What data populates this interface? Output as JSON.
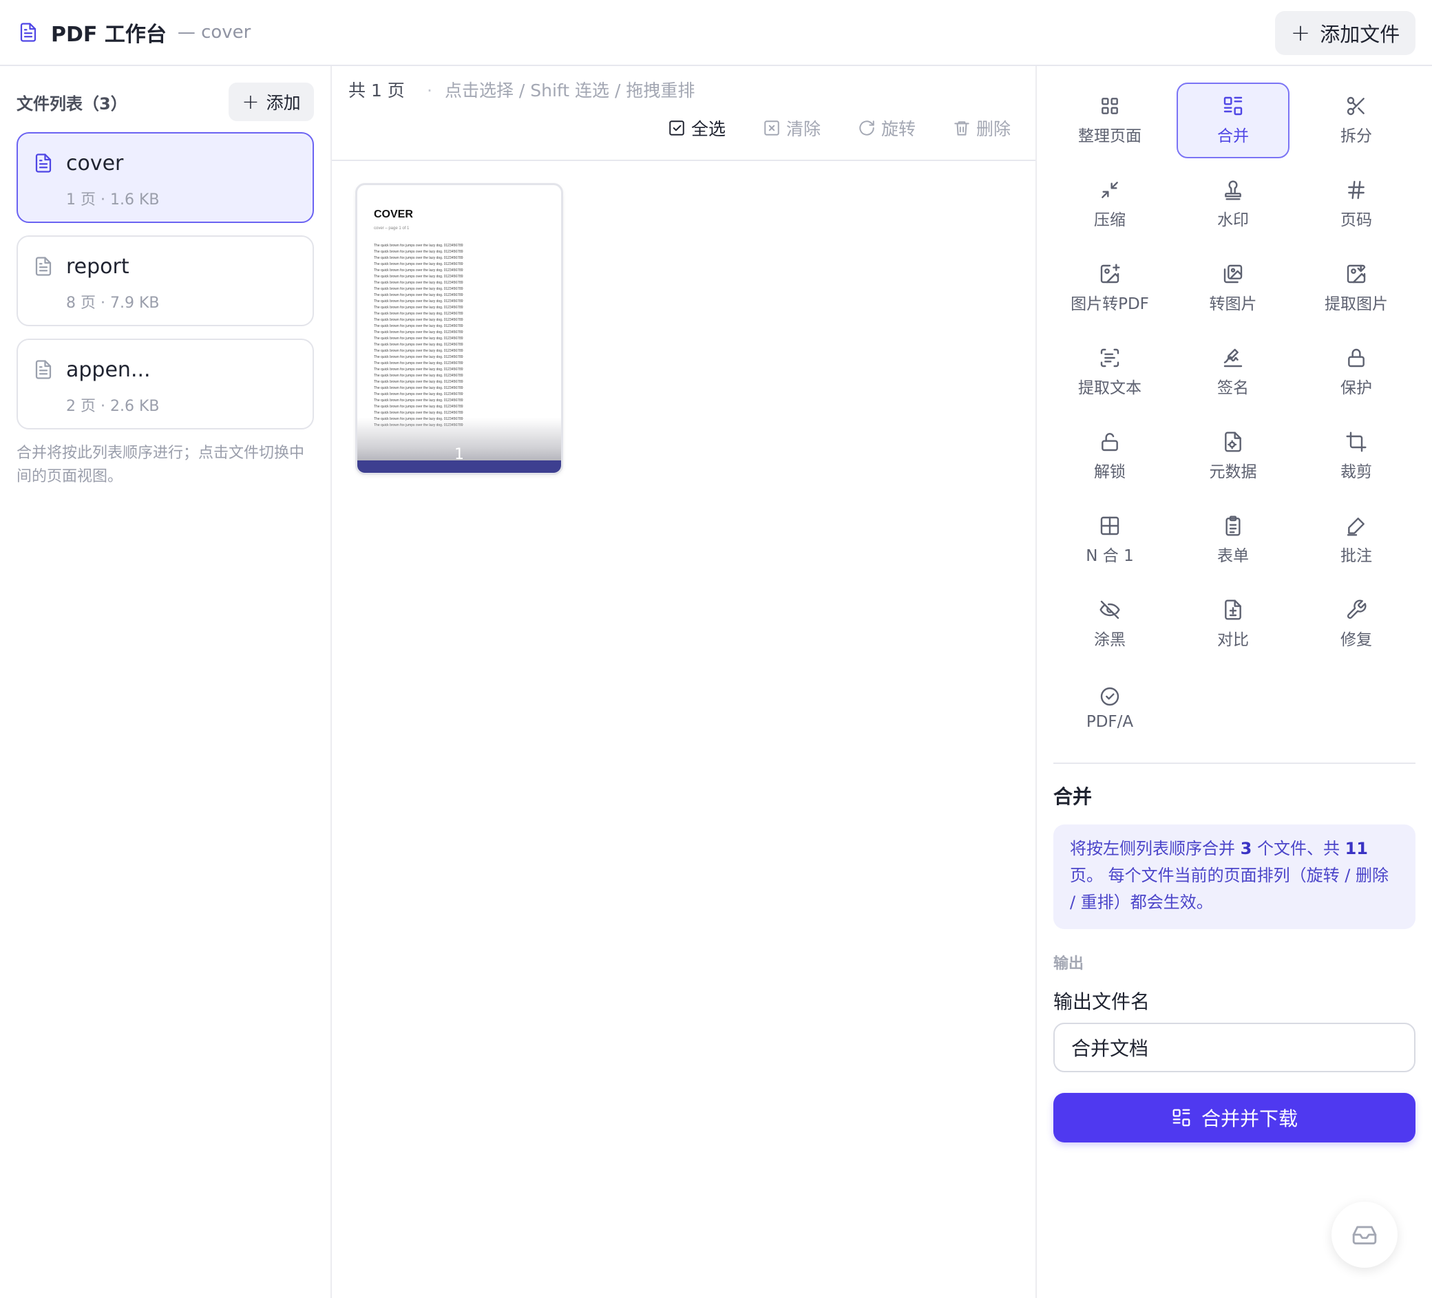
{
  "header": {
    "title": "PDF 工作台",
    "subtitle": "— cover",
    "add_file_label": "添加文件"
  },
  "sidebar": {
    "title": "文件列表（3）",
    "add_label": "添加",
    "files": [
      {
        "name": "cover",
        "meta": "1 页 · 1.6 KB",
        "active": true
      },
      {
        "name": "report",
        "meta": "8 页 · 7.9 KB",
        "active": false
      },
      {
        "name": "appen...",
        "meta": "2 页 · 2.6 KB",
        "active": false
      }
    ],
    "hint": "合并将按此列表顺序进行；点击文件切换中间的页面视图。"
  },
  "center": {
    "page_count": "共 1 页",
    "hint": "点击选择 / Shift 连选 / 拖拽重排",
    "toolbar": {
      "select_all": "全选",
      "clear": "清除",
      "rotate": "旋转",
      "delete": "删除"
    },
    "thumbnail": {
      "title": "COVER",
      "subtitle": "cover – page 1 of 1",
      "line_text": "The quick brown fox jumps over the lazy dog. 0123456789",
      "page_number": "1"
    }
  },
  "tools": [
    {
      "label": "整理页面",
      "icon": "grid-icon",
      "active": false
    },
    {
      "label": "合并",
      "icon": "merge-icon",
      "active": true
    },
    {
      "label": "拆分",
      "icon": "scissors-icon",
      "active": false
    },
    {
      "label": "压缩",
      "icon": "compress-icon",
      "active": false
    },
    {
      "label": "水印",
      "icon": "stamp-icon",
      "active": false
    },
    {
      "label": "页码",
      "icon": "hash-icon",
      "active": false
    },
    {
      "label": "图片转PDF",
      "icon": "image-plus-icon",
      "active": false
    },
    {
      "label": "转图片",
      "icon": "images-icon",
      "active": false
    },
    {
      "label": "提取图片",
      "icon": "image-down-icon",
      "active": false
    },
    {
      "label": "提取文本",
      "icon": "scan-text-icon",
      "active": false
    },
    {
      "label": "签名",
      "icon": "signature-icon",
      "active": false
    },
    {
      "label": "保护",
      "icon": "lock-icon",
      "active": false
    },
    {
      "label": "解锁",
      "icon": "unlock-icon",
      "active": false
    },
    {
      "label": "元数据",
      "icon": "file-cog-icon",
      "active": false
    },
    {
      "label": "裁剪",
      "icon": "crop-icon",
      "active": false
    },
    {
      "label": "N 合 1",
      "icon": "layout-grid-icon",
      "active": false
    },
    {
      "label": "表单",
      "icon": "clipboard-list-icon",
      "active": false
    },
    {
      "label": "批注",
      "icon": "pen-icon",
      "active": false
    },
    {
      "label": "涂黑",
      "icon": "eye-off-icon",
      "active": false
    },
    {
      "label": "对比",
      "icon": "file-diff-icon",
      "active": false
    },
    {
      "label": "修复",
      "icon": "wrench-icon",
      "active": false
    },
    {
      "label": "PDF/A",
      "icon": "badge-check-icon",
      "active": false
    }
  ],
  "panel": {
    "title": "合并",
    "info_prefix": "将按左侧列表顺序合并 ",
    "info_files": "3",
    "info_mid": " 个文件、共 ",
    "info_pages": "11",
    "info_suffix": " 页。 每个文件当前的页面排列（旋转 / 删除 / 重排）都会生效。",
    "output_section": "输出",
    "filename_label": "输出文件名",
    "filename_value": "合并文档",
    "submit_label": "合并并下载"
  },
  "colors": {
    "accent": "#4f46e5",
    "button": "#4f39f0",
    "active_bg": "#eeefff"
  }
}
